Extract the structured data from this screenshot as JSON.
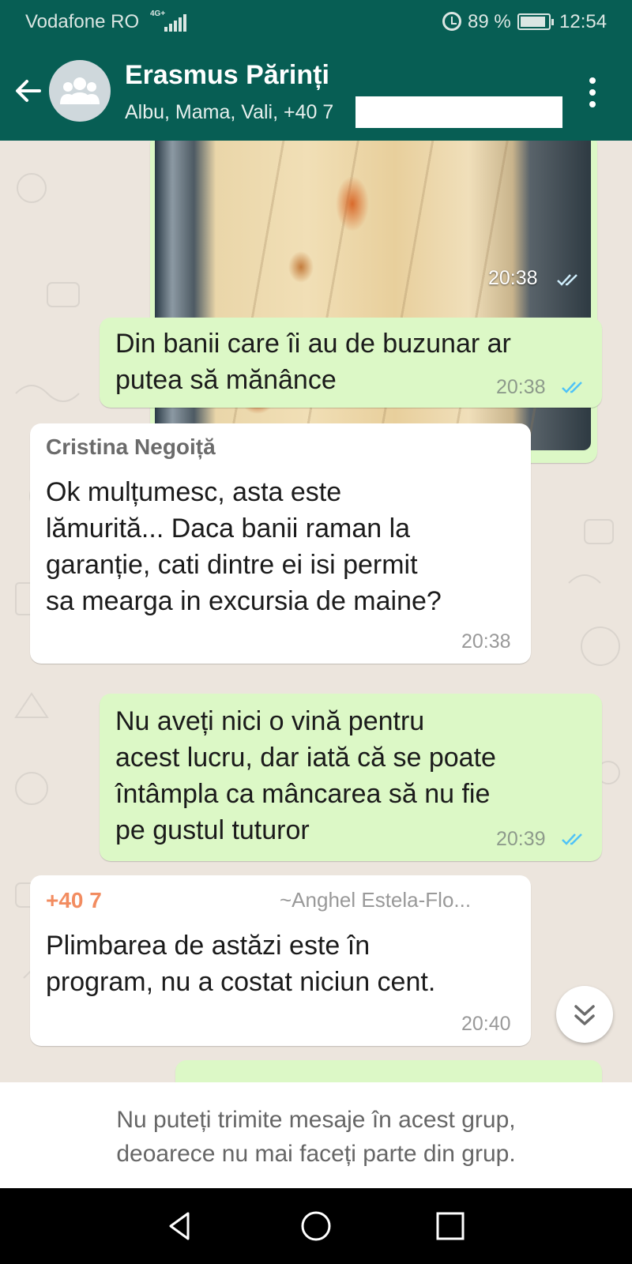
{
  "status_bar": {
    "carrier": "Vodafone RO",
    "network": "4G+",
    "battery": "89 %",
    "time": "12:54"
  },
  "header": {
    "title": "Erasmus Părinți",
    "subtitle": "Albu, Mama, Vali, +40 7",
    "back_icon": "arrow-left-icon",
    "avatar_icon": "group-icon",
    "menu_icon": "more-vertical-icon"
  },
  "messages": [
    {
      "type": "image",
      "direction": "outgoing",
      "time": "20:38",
      "status": "read"
    },
    {
      "type": "text",
      "direction": "outgoing",
      "lines": [
        "Din banii care îi au de buzunar ar",
        "putea să mănânce"
      ],
      "time": "20:38",
      "status": "read"
    },
    {
      "type": "text",
      "direction": "incoming",
      "sender": "Cristina Negoiță",
      "lines": [
        "Ok mulțumesc, asta este",
        "lămurită...  Daca banii raman la",
        "garanție, cati dintre ei isi permit",
        "sa mearga in excursia de maine?"
      ],
      "time": "20:38"
    },
    {
      "type": "text",
      "direction": "outgoing",
      "lines": [
        "Nu aveți nici o vină pentru",
        "acest lucru, dar iată că se poate",
        "întâmpla ca mâncarea să nu fie",
        "pe gustul tuturor"
      ],
      "time": "20:39",
      "status": "read"
    },
    {
      "type": "text",
      "direction": "incoming",
      "sender_phone": "+40 7",
      "sender_name": "~Anghel Estela-Flo...",
      "lines": [
        "Plimbarea de astăzi este în",
        "program, nu a costat niciun cent."
      ],
      "time": "20:40"
    }
  ],
  "footer": {
    "notice_line1": "Nu puteți trimite mesaje în acest grup,",
    "notice_line2": "deoarece nu mai faceți parte din grup."
  },
  "colors": {
    "header": "#075e54",
    "outgoing_bubble": "#dcf8c6",
    "incoming_bubble": "#ffffff",
    "read_ticks": "#4fc3f7",
    "sender_phone": "#f28c60"
  },
  "scroll_button_icon": "double-chevron-down-icon",
  "nav_icons": [
    "back-triangle-icon",
    "home-circle-icon",
    "recents-square-icon"
  ]
}
